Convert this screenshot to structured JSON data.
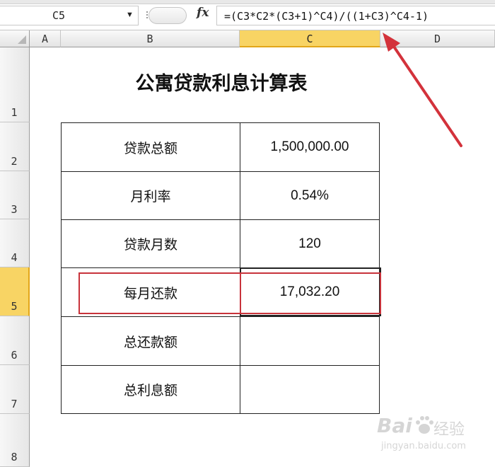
{
  "formula_bar": {
    "name_box": "C5",
    "fx_label": "fx",
    "formula": "=(C3*C2*(C3+1)^C4)/((1+C3)^C4-1)"
  },
  "columns": [
    "A",
    "B",
    "C",
    "D"
  ],
  "rows": [
    "1",
    "2",
    "3",
    "4",
    "5",
    "6",
    "7",
    "8"
  ],
  "selected_cell": "C5",
  "sheet": {
    "title": "公寓贷款利息计算表",
    "table": [
      {
        "label": "贷款总额",
        "value": "1,500,000.00"
      },
      {
        "label": "月利率",
        "value": "0.54%"
      },
      {
        "label": "贷款月数",
        "value": "120"
      },
      {
        "label": "每月还款",
        "value": "17,032.20"
      },
      {
        "label": "总还款额",
        "value": ""
      },
      {
        "label": "总利息额",
        "value": ""
      }
    ]
  },
  "annotation_color": "#c8333b",
  "watermark": {
    "brand": "Bai",
    "suffix": "经验",
    "url": "jingyan.baidu.com"
  }
}
